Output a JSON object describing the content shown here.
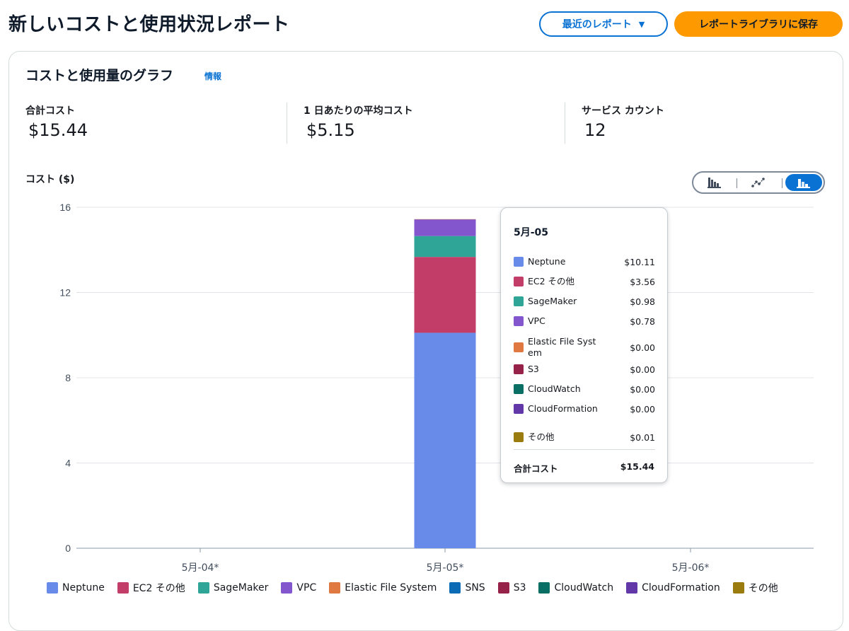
{
  "header": {
    "title": "新しいコストと使用状況レポート",
    "recent_reports_label": "最近のレポート",
    "save_label": "レポートライブラリに保存"
  },
  "panel": {
    "title": "コストと使用量のグラフ",
    "info_link": "情報"
  },
  "kpis": [
    {
      "label": "合計コスト",
      "value": "$15.44"
    },
    {
      "label": "1 日あたりの平均コスト",
      "value": "$5.15"
    },
    {
      "label": "サービス カウント",
      "value": "12"
    }
  ],
  "chart_view_toggle": {
    "options": [
      "bar-chart-icon",
      "line-chart-icon",
      "stacked-bar-chart-icon"
    ],
    "selected": "stacked-bar-chart-icon"
  },
  "chart_data": {
    "type": "bar",
    "stacked": true,
    "ylabel": "コスト ($)",
    "ylim": [
      0,
      16
    ],
    "yticks": [
      0,
      4,
      8,
      12,
      16
    ],
    "grid": true,
    "categories": [
      "5月-04*",
      "5月-05*",
      "5月-06*"
    ],
    "series": [
      {
        "name": "Neptune",
        "color": "#688ae8",
        "values": [
          0,
          10.11,
          0
        ]
      },
      {
        "name": "EC2 その他",
        "color": "#c33d69",
        "values": [
          0,
          3.56,
          0
        ]
      },
      {
        "name": "SageMaker",
        "color": "#2ea597",
        "values": [
          0,
          0.98,
          0
        ]
      },
      {
        "name": "VPC",
        "color": "#8456ce",
        "values": [
          0,
          0.78,
          0
        ]
      },
      {
        "name": "Elastic File System",
        "color": "#e07941",
        "values": [
          0,
          0.0,
          0
        ]
      },
      {
        "name": "SNS",
        "color": "#3759ce",
        "values": [
          0,
          0,
          0
        ]
      },
      {
        "name": "S3",
        "color": "#962249",
        "values": [
          0,
          0.0,
          0
        ]
      },
      {
        "name": "CloudWatch",
        "color": "#096f64",
        "values": [
          0,
          0.0,
          0
        ]
      },
      {
        "name": "CloudFormation",
        "color": "#6237a7",
        "values": [
          0,
          0.0,
          0
        ]
      },
      {
        "name": "その他",
        "color": "#a84401",
        "values": [
          0,
          0.01,
          0
        ]
      }
    ],
    "legend": {
      "placement": "bottom",
      "entries": [
        {
          "name": "Neptune",
          "color": "#688ae8"
        },
        {
          "name": "EC2 その他",
          "color": "#c33d69"
        },
        {
          "name": "SageMaker",
          "color": "#2ea597"
        },
        {
          "name": "VPC",
          "color": "#8456ce"
        },
        {
          "name": "Elastic File System",
          "color": "#e07941"
        },
        {
          "name": "SNS",
          "color": "#0b6bb5"
        },
        {
          "name": "S3",
          "color": "#962249"
        },
        {
          "name": "CloudWatch",
          "color": "#096f64"
        },
        {
          "name": "CloudFormation",
          "color": "#6237a7"
        },
        {
          "name": "その他",
          "color": "#9a7b0e"
        }
      ]
    },
    "tooltip": {
      "title": "5月-05",
      "rows": [
        {
          "name": "Neptune",
          "value": "$10.11",
          "color": "#688ae8"
        },
        {
          "name": "EC2 その他",
          "value": "$3.56",
          "color": "#c33d69"
        },
        {
          "name": "SageMaker",
          "value": "$0.98",
          "color": "#2ea597"
        },
        {
          "name": "VPC",
          "value": "$0.78",
          "color": "#8456ce"
        },
        {
          "name": "Elastic File System",
          "value": "$0.00",
          "color": "#e07941"
        },
        {
          "name": "S3",
          "value": "$0.00",
          "color": "#962249"
        },
        {
          "name": "CloudWatch",
          "value": "$0.00",
          "color": "#096f64"
        },
        {
          "name": "CloudFormation",
          "value": "$0.00",
          "color": "#6237a7"
        },
        {
          "name": "その他",
          "value": "$0.01",
          "color": "#9a7b0e"
        }
      ],
      "total_label": "合計コスト",
      "total_value": "$15.44"
    }
  }
}
